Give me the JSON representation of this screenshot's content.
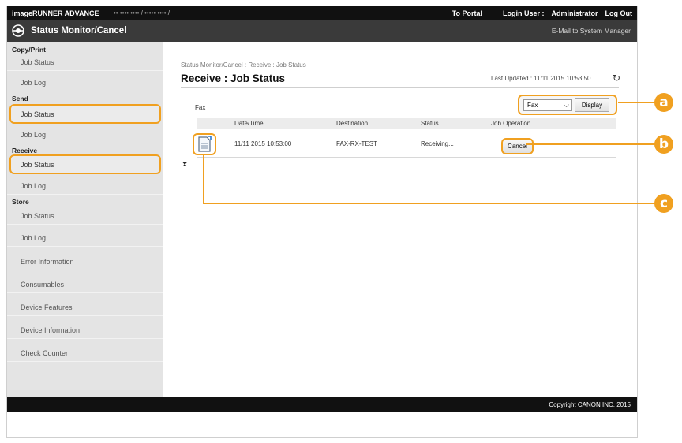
{
  "topbar": {
    "brand": "imageRUNNER ADVANCE",
    "path": "•• •••• •••• / ••••• •••• /",
    "portal": "To Portal",
    "login_label": "Login User :",
    "login_user": "Administrator",
    "logout": "Log Out"
  },
  "titlebar": {
    "title": "Status Monitor/Cancel",
    "mail": "E-Mail to System Manager"
  },
  "sidebar": {
    "copy_print": "Copy/Print",
    "send": "Send",
    "receive": "Receive",
    "store": "Store",
    "job_status": "Job Status",
    "job_log": "Job Log",
    "error_information": "Error Information",
    "consumables": "Consumables",
    "device_features": "Device Features",
    "device_information": "Device Information",
    "check_counter": "Check Counter"
  },
  "main": {
    "breadcrumb": "Status Monitor/Cancel : Receive : Job Status",
    "page_title": "Receive : Job Status",
    "last_updated": "Last Updated : 11/11 2015 10:53:50",
    "fax_label": "Fax",
    "select_value": "Fax",
    "display_button": "Display",
    "columns": {
      "datetime": "Date/Time",
      "destination": "Destination",
      "status": "Status",
      "operation": "Job Operation"
    },
    "row": {
      "datetime": "11/11 2015 10:53:00",
      "destination": "FAX-RX-TEST",
      "status": "Receiving...",
      "cancel": "Cancel"
    }
  },
  "footer": {
    "copyright": "Copyright CANON INC. 2015"
  },
  "callouts": {
    "a": "a",
    "b": "b",
    "c": "c"
  },
  "colors": {
    "accent": "#f0a020",
    "topbar": "#111111",
    "titlebar": "#3a3a3a",
    "sidebar": "#e4e4e4"
  }
}
